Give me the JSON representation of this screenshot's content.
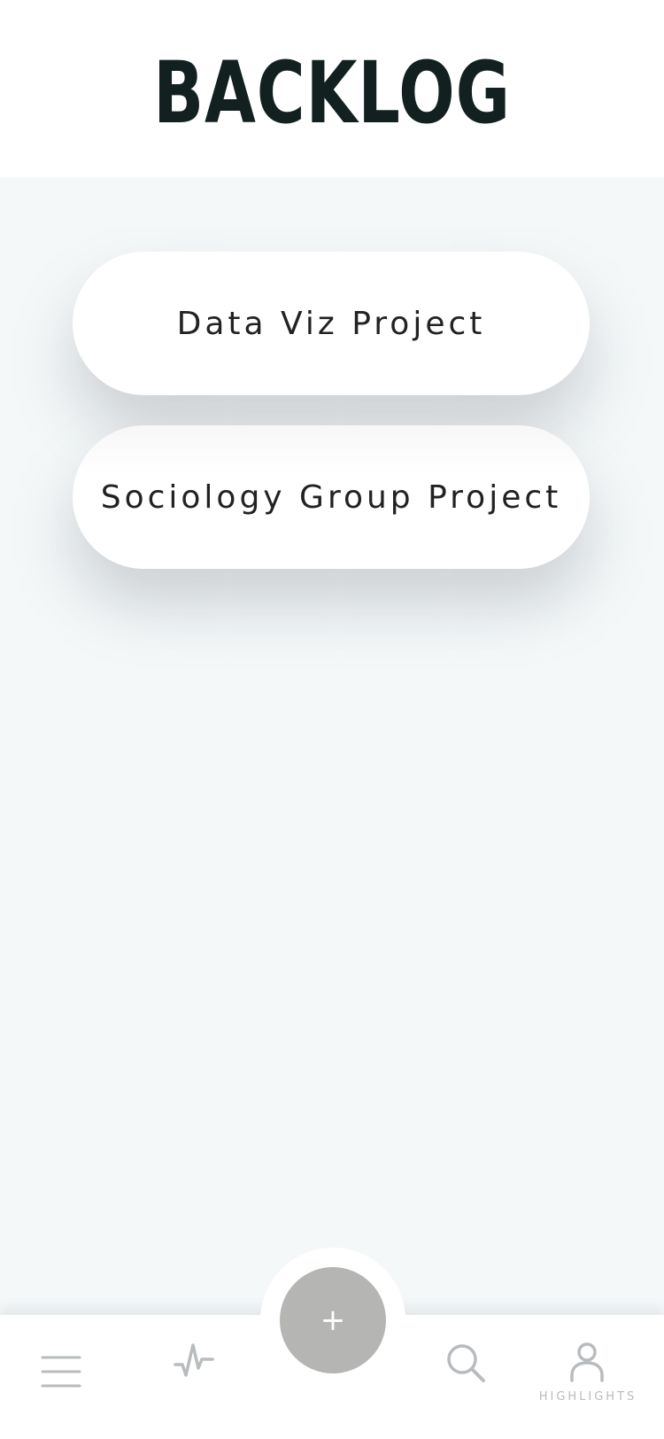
{
  "header": {
    "title": "BACKLOG"
  },
  "projects": [
    {
      "label": "Data Viz Project"
    },
    {
      "label": "Sociology Group Project"
    }
  ],
  "fab": {
    "label": "+"
  },
  "nav": {
    "items": [
      {
        "icon": "menu-icon"
      },
      {
        "icon": "activity-icon"
      },
      {
        "icon": "search-icon"
      },
      {
        "icon": "user-icon",
        "caption": "HIGHLIGHTS"
      }
    ]
  },
  "colors": {
    "title": "#122120",
    "background": "#f4f8f9",
    "card": "#ffffff",
    "fab": "#b5b5b3",
    "nav_icon": "#b8bcbe"
  }
}
